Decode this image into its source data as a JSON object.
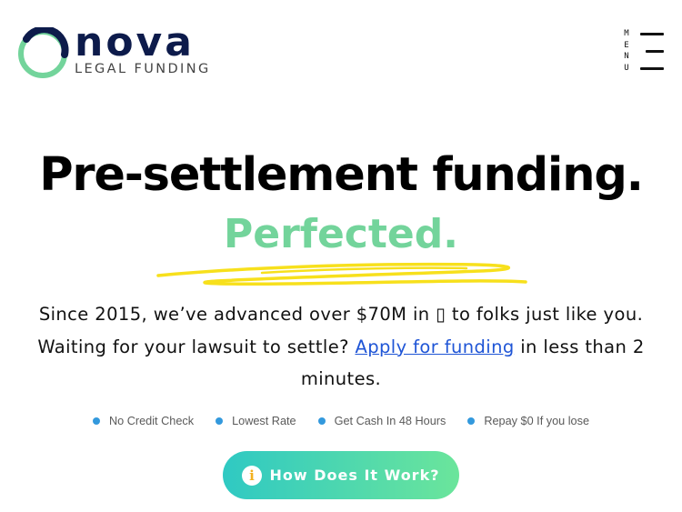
{
  "brand": {
    "name": "nova",
    "tagline": "LEGAL FUNDING"
  },
  "menu": {
    "label": "MENU",
    "icon": "hamburger-icon"
  },
  "hero": {
    "headline": "Pre-settlement funding.",
    "accent": "Perfected.",
    "intro_before": "Since 2015, we’ve advanced over $70M in ",
    "intro_glyph": "▯",
    "intro_middle": " to folks just like you. Waiting for your lawsuit to settle? ",
    "apply_link": "Apply for funding",
    "intro_after": " in less than 2 minutes."
  },
  "features": [
    {
      "label": "No Credit Check"
    },
    {
      "label": "Lowest Rate"
    },
    {
      "label": "Get Cash In 48 Hours"
    },
    {
      "label": "Repay $0 If you lose"
    }
  ],
  "cta": {
    "label": "How Does It Work?",
    "icon_glyph": "i",
    "icon": "info-icon"
  },
  "colors": {
    "brand_navy": "#0d1b4b",
    "accent_green": "#73d49b",
    "link_blue": "#1f55d6",
    "bullet_blue": "#3399dd",
    "scribble_yellow": "#f7e01c",
    "cta_gradient_start": "#2fc9c3",
    "cta_gradient_end": "#6be59b"
  }
}
